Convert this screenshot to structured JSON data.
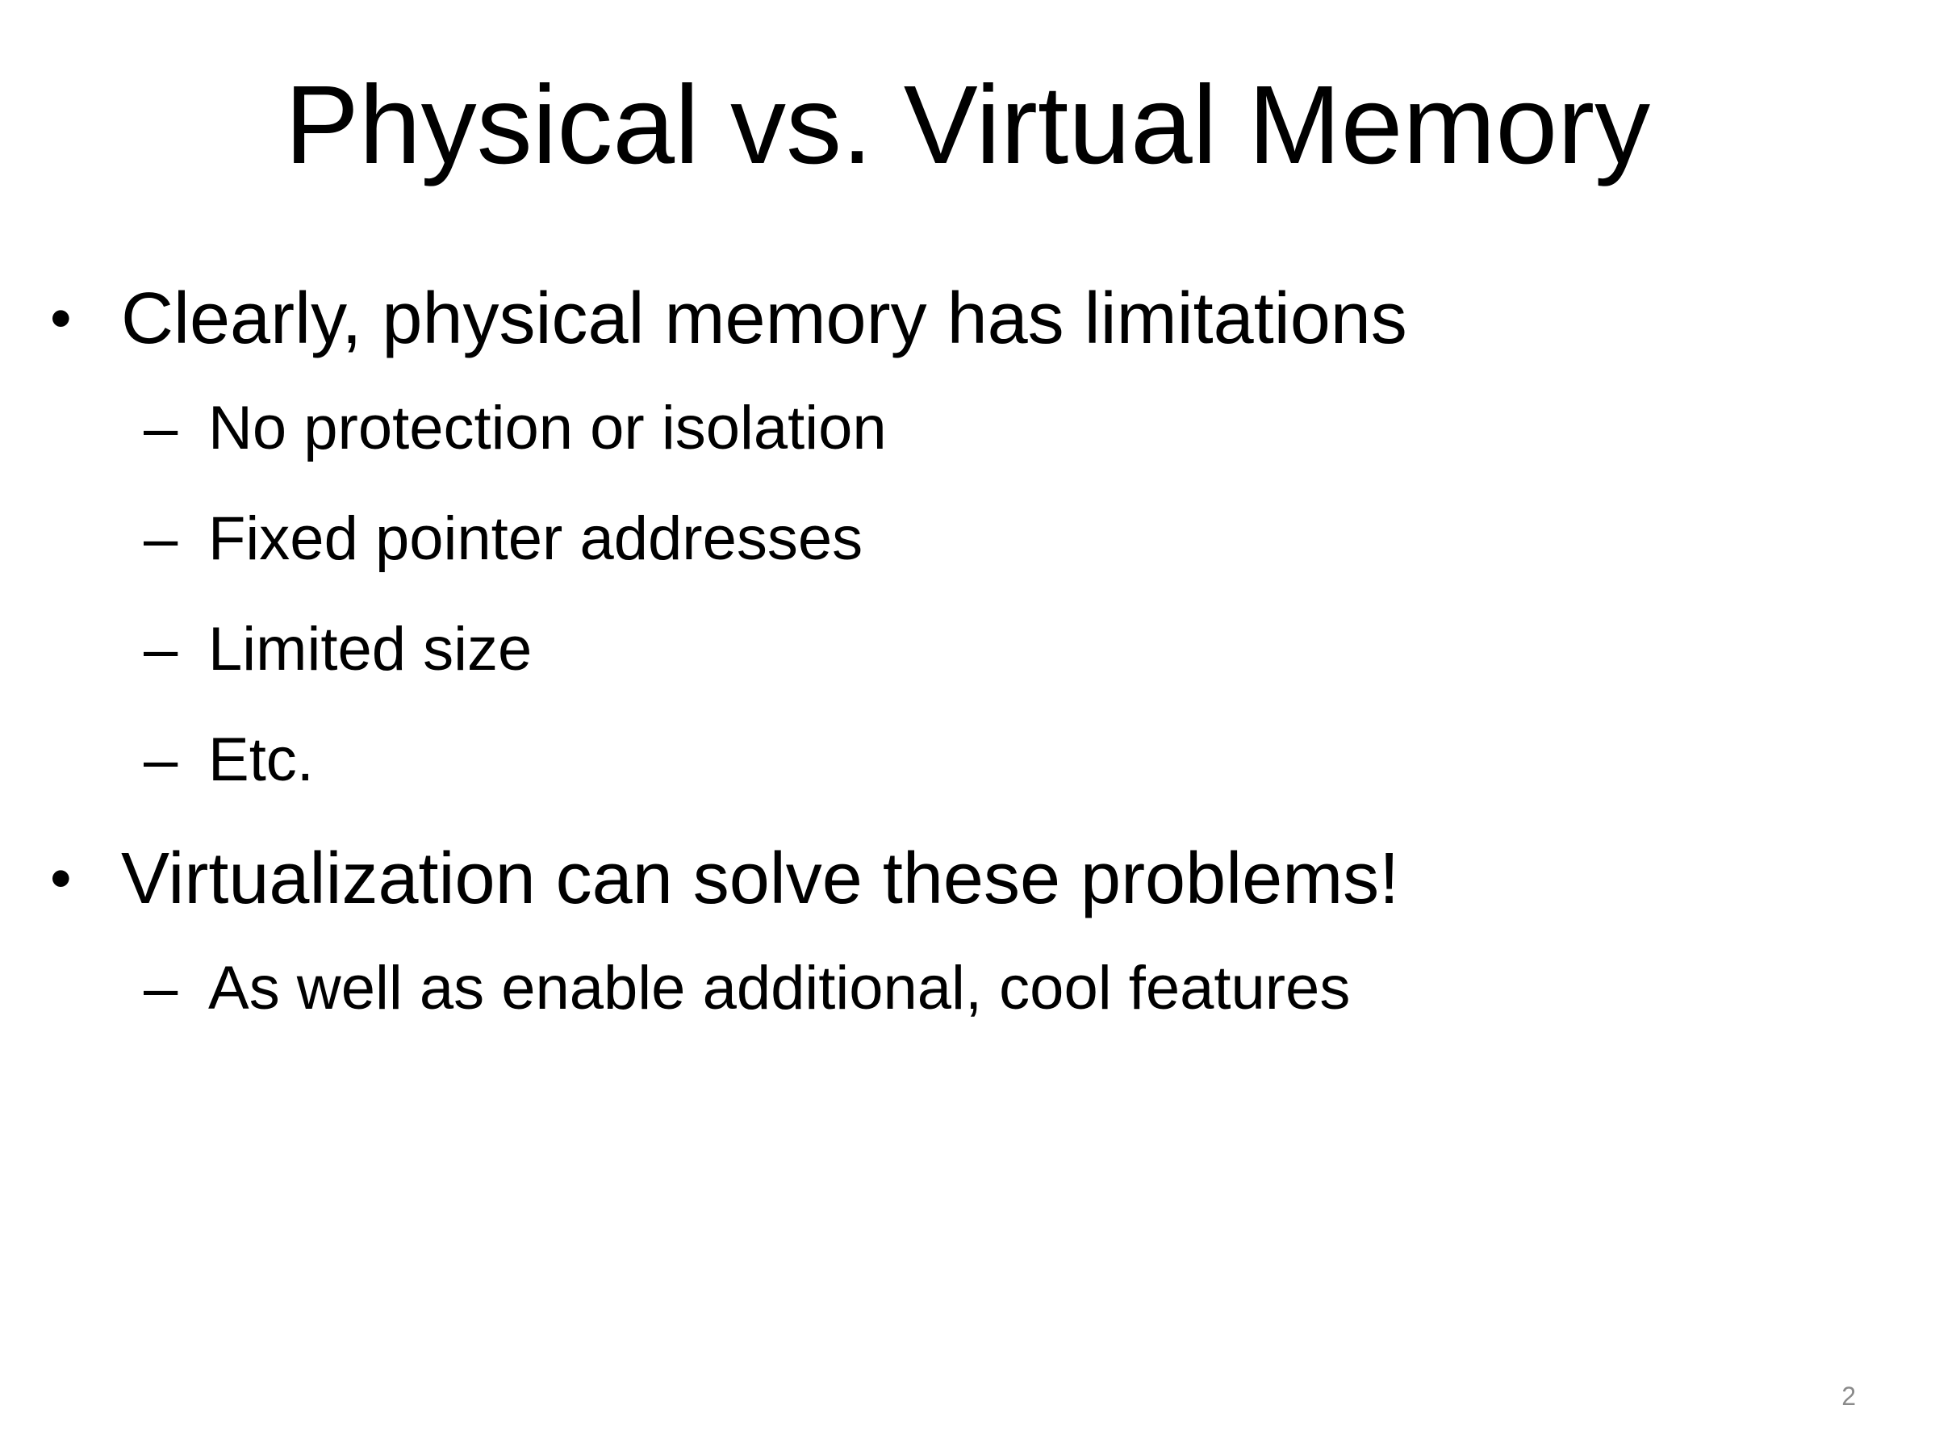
{
  "slide": {
    "title": "Physical vs. Virtual Memory",
    "page_number": "2",
    "bullets": [
      {
        "text": "Clearly, physical memory has limitations",
        "sub": [
          "No protection or isolation",
          "Fixed pointer addresses",
          "Limited size",
          "Etc."
        ]
      },
      {
        "text": "Virtualization can solve these problems!",
        "sub": [
          "As well as enable additional, cool features"
        ]
      }
    ],
    "bullet_glyph": "•",
    "dash_glyph": "–"
  }
}
